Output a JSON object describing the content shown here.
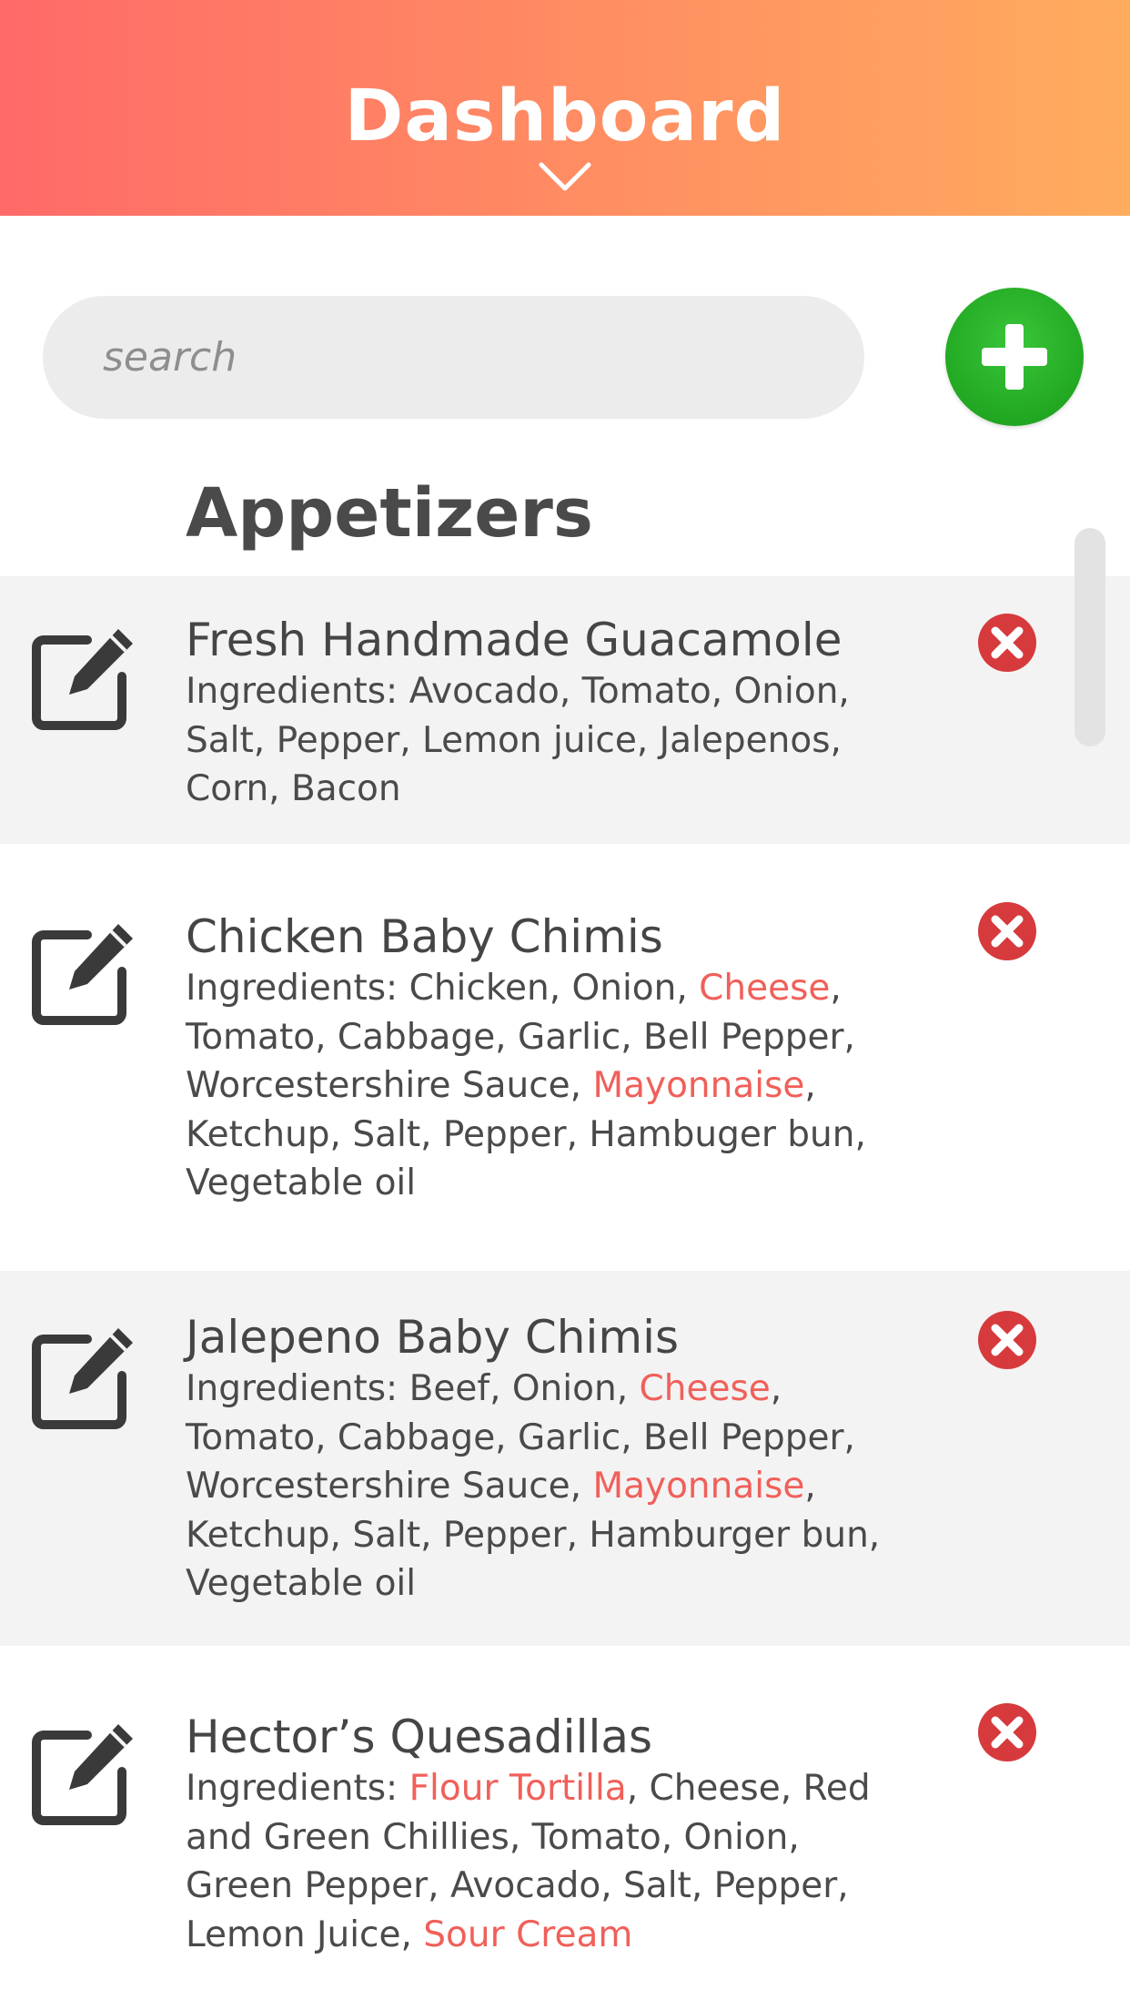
{
  "header": {
    "title": "Dashboard",
    "chevron_icon": "chevron-down-icon",
    "gradient": [
      "#ff6a68",
      "#ffac5e"
    ]
  },
  "search": {
    "placeholder": "search",
    "value": ""
  },
  "add_button": {
    "icon": "plus-icon",
    "color": "#22a822"
  },
  "section": {
    "title": "Appetizers"
  },
  "colors": {
    "highlight": "#f0605a",
    "delete": "#d63a3d",
    "row_shaded": "#f3f3f3"
  },
  "items": [
    {
      "title": "Fresh Handmade Guacamole",
      "lines": [
        [
          {
            "t": "Ingredients: Avocado, Tomato, Onion,"
          }
        ],
        [
          {
            "t": "Salt, Pepper, Lemon juice, Jalepenos,"
          }
        ],
        [
          {
            "t": "Corn, Bacon"
          }
        ]
      ]
    },
    {
      "title": "Chicken Baby Chimis",
      "lines": [
        [
          {
            "t": "Ingredients: Chicken, Onion, "
          },
          {
            "t": "Cheese",
            "hl": true
          },
          {
            "t": ","
          }
        ],
        [
          {
            "t": "Tomato, Cabbage, Garlic, Bell Pepper,"
          }
        ],
        [
          {
            "t": "Worcestershire Sauce, "
          },
          {
            "t": "Mayonnaise",
            "hl": true
          },
          {
            "t": ","
          }
        ],
        [
          {
            "t": "Ketchup, Salt, Pepper, Hambuger bun,"
          }
        ],
        [
          {
            "t": "Vegetable oil"
          }
        ]
      ]
    },
    {
      "title": "Jalepeno Baby Chimis",
      "lines": [
        [
          {
            "t": "Ingredients: Beef, Onion, "
          },
          {
            "t": "Cheese",
            "hl": true
          },
          {
            "t": ","
          }
        ],
        [
          {
            "t": "Tomato, Cabbage, Garlic, Bell Pepper,"
          }
        ],
        [
          {
            "t": "Worcestershire Sauce, "
          },
          {
            "t": "Mayonnaise",
            "hl": true
          },
          {
            "t": ","
          }
        ],
        [
          {
            "t": "Ketchup, Salt, Pepper, Hamburger bun,"
          }
        ],
        [
          {
            "t": "Vegetable oil"
          }
        ]
      ]
    },
    {
      "title": "Hector’s Quesadillas",
      "lines": [
        [
          {
            "t": "Ingredients: "
          },
          {
            "t": "Flour Tortilla",
            "hl": true
          },
          {
            "t": ", Cheese, Red"
          }
        ],
        [
          {
            "t": "and Green Chillies, Tomato, Onion,"
          }
        ],
        [
          {
            "t": "Green Pepper, Avocado, Salt, Pepper,"
          }
        ],
        [
          {
            "t": "Lemon Juice, "
          },
          {
            "t": "Sour Cream",
            "hl": true
          }
        ]
      ]
    }
  ]
}
